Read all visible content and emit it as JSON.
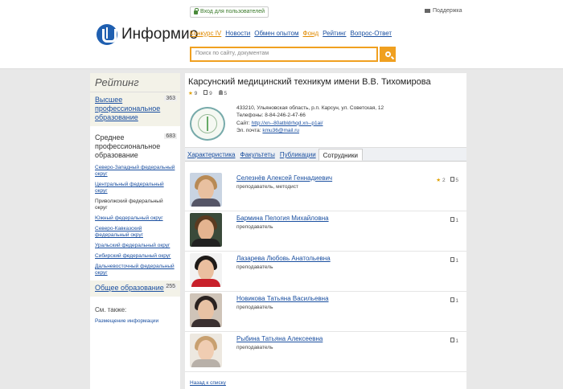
{
  "header": {
    "logo_text": "Информио",
    "login_label": "Вход для пользователей",
    "support_label": "Поддержка",
    "nav": [
      "Конкурс IV",
      "Новости",
      "Обмен опытом",
      "Фонд",
      "Рейтинг",
      "Вопрос-Ответ"
    ],
    "search_placeholder": "Поиск по сайту, документам"
  },
  "sidebar": {
    "title": "Рейтинг",
    "higher": {
      "label": "Высшее профессиональное образование",
      "count": "363"
    },
    "secondary": {
      "label": "Среднее профессиональное образование",
      "count": "683"
    },
    "districts": [
      "Северо-Западный федеральный округ",
      "Центральный федеральный округ",
      "Приволжский федеральный округ",
      "Южный федеральный округ",
      "Северо-Кавказский федеральный округ",
      "Уральский федеральный округ",
      "Сибирский федеральный округ",
      "Дальневосточный федеральный округ"
    ],
    "general": {
      "label": "Общее образование",
      "count": "255"
    },
    "see_also": "См. также:",
    "see_link": "Размещение информации"
  },
  "org": {
    "title": "Карсунский медицинский техникум имени В.В. Тихомирова",
    "stats": {
      "stars": "9",
      "docs": "9",
      "people": "5"
    },
    "address": "433210, Ульяновская область, р.п. Карсун, ул. Советская, 12",
    "phone": "Телефоны: 8-84-246-2-47-66",
    "site_label": "Сайт:",
    "site": "http://xn--80atbldrhqd.xn--p1ai/",
    "email_label": "Эл. почта:",
    "email": "kmu36@mail.ru"
  },
  "tabs": [
    "Характеристика",
    "Факультеты",
    "Публикации",
    "Сотрудники"
  ],
  "staff": [
    {
      "name": "Селезнёв Алексей Геннадиевич",
      "role": "преподаватель, методист",
      "stars": "2",
      "docs": "5"
    },
    {
      "name": "Бармина Пелогия Михайловна",
      "role": "преподаватель",
      "stars": "",
      "docs": "1"
    },
    {
      "name": "Лазарева Любовь Анатольевна",
      "role": "преподаватель",
      "stars": "",
      "docs": "1"
    },
    {
      "name": "Новикова Татьяна Васильевна",
      "role": "преподаватель",
      "stars": "",
      "docs": "1"
    },
    {
      "name": "Рыбина Татьяна Алексеевна",
      "role": "преподаватель",
      "stars": "",
      "docs": "1"
    }
  ],
  "back_link": "Назад к списку",
  "colors": {
    "accent": "#f0a020",
    "link": "#1a4fa0"
  }
}
